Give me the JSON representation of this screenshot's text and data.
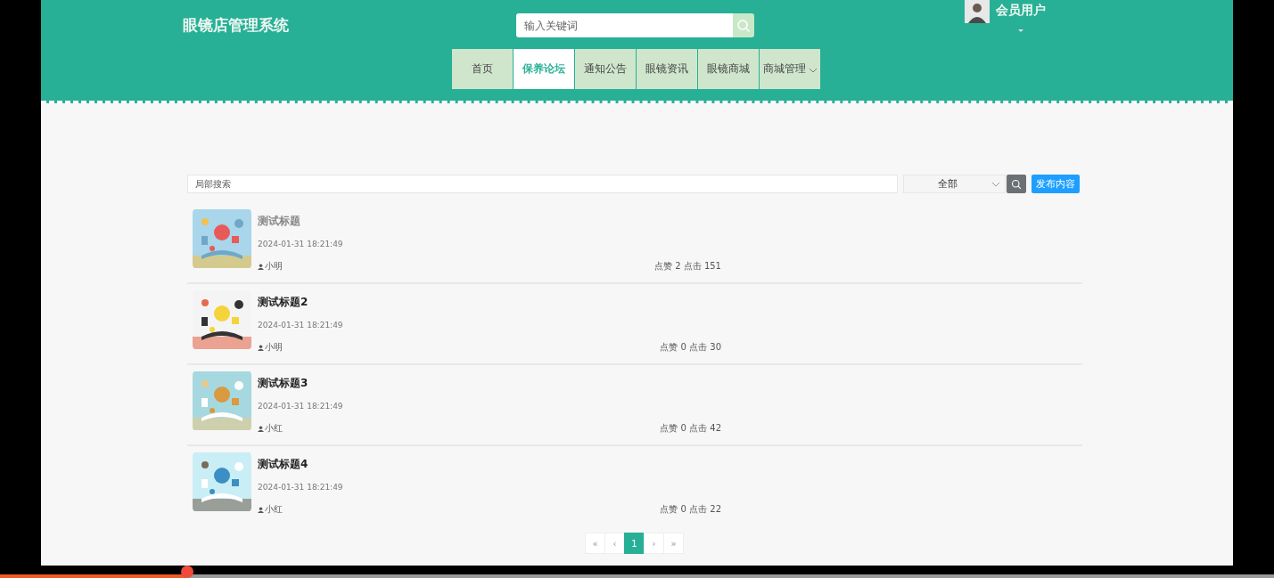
{
  "header": {
    "site_title": "眼镜店管理系统",
    "search": {
      "placeholder": "输入关键词"
    },
    "user": {
      "name": "会员用户"
    }
  },
  "nav": [
    {
      "label": "首页",
      "selected": false,
      "has_menu": false
    },
    {
      "label": "保养论坛",
      "selected": true,
      "has_menu": false
    },
    {
      "label": "通知公告",
      "selected": false,
      "has_menu": false
    },
    {
      "label": "眼镜资讯",
      "selected": false,
      "has_menu": false
    },
    {
      "label": "眼镜商城",
      "selected": false,
      "has_menu": false
    },
    {
      "label": "商城管理",
      "selected": false,
      "has_menu": true
    }
  ],
  "filter": {
    "search": {
      "placeholder": "局部搜索"
    },
    "category": "全部",
    "publish_button": "发布内容"
  },
  "posts": [
    {
      "title": "测试标题",
      "hovered": true,
      "time": "2024-01-31 18:21:49",
      "author": "小明",
      "stats": "点赞 2 点击 151"
    },
    {
      "title": "测试标题2",
      "hovered": false,
      "time": "2024-01-31 18:21:49",
      "author": "小明",
      "stats": "点赞 0 点击 30"
    },
    {
      "title": "测试标题3",
      "hovered": false,
      "time": "2024-01-31 18:21:49",
      "author": "小红",
      "stats": "点赞 0 点击 42"
    },
    {
      "title": "测试标题4",
      "hovered": false,
      "time": "2024-01-31 18:21:49",
      "author": "小红",
      "stats": "点赞 0 点击 22"
    }
  ],
  "pagination": [
    {
      "label": "«",
      "selected": false
    },
    {
      "label": "‹",
      "selected": false
    },
    {
      "label": "1",
      "selected": true
    },
    {
      "label": "›",
      "selected": false
    },
    {
      "label": "»",
      "selected": false
    }
  ],
  "video_progress": {
    "level": 0.147
  }
}
